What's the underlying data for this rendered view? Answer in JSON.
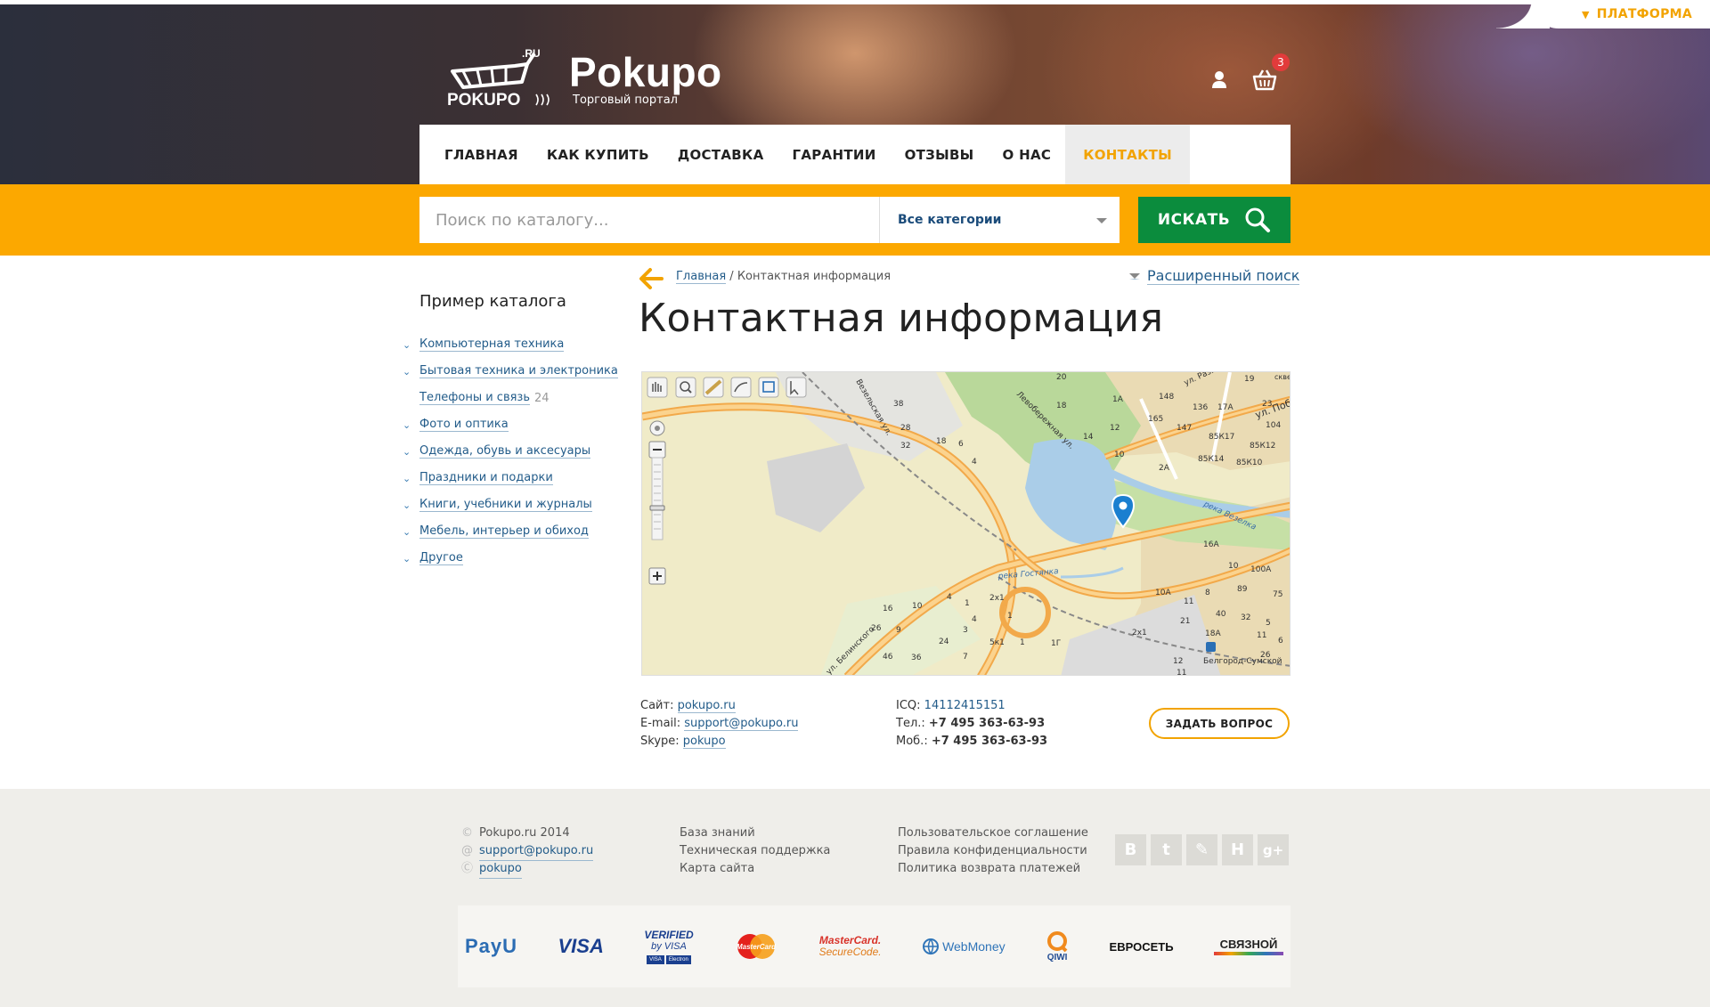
{
  "header": {
    "platform_label": "ПЛАТФОРМА",
    "logo_title": "Pokupo",
    "logo_subtitle": "Торговый портал",
    "logo_mark_text": "POKUPO",
    "logo_ru": ".RU",
    "cart_count": "3"
  },
  "nav": {
    "items": [
      {
        "label": "ГЛАВНАЯ"
      },
      {
        "label": "КАК КУПИТЬ"
      },
      {
        "label": "ДОСТАВКА"
      },
      {
        "label": "ГАРАНТИИ"
      },
      {
        "label": "ОТЗЫВЫ"
      },
      {
        "label": "О НАС"
      },
      {
        "label": "КОНТАКТЫ"
      }
    ],
    "active": "КОНТАКТЫ"
  },
  "search": {
    "placeholder": "Поиск по каталогу...",
    "category": "Все категории",
    "button": "ИСКАТЬ"
  },
  "sidebar": {
    "title": "Пример каталога",
    "items": [
      {
        "label": "Компьютерная техника"
      },
      {
        "label": "Бытовая техника и электроника"
      },
      {
        "label": "Телефоны и связь",
        "count": "24"
      },
      {
        "label": "Фото и оптика"
      },
      {
        "label": "Одежда, обувь и аксесуары"
      },
      {
        "label": "Праздники и подарки"
      },
      {
        "label": "Книги, учебники и журналы"
      },
      {
        "label": "Мебель, интерьер и обиход"
      },
      {
        "label": "Другое"
      }
    ]
  },
  "breadcrumb": {
    "home": "Главная",
    "separator": "/",
    "current": "Контактная информация"
  },
  "advanced_search": "Расширенный поиск",
  "page_title": "Контактная информация",
  "map": {
    "labels": {
      "street1": "ул. Победы",
      "street2": "Везельская ул.",
      "street3": "Левобережная ул.",
      "street4": "ул. Разина",
      "river1": "река Везелка",
      "river2": "река Гостянка",
      "station": "Белгород-Сумской",
      "street5": "ул. Белинского",
      "corner": "сквер",
      "n20": "20",
      "n38": "38",
      "n28": "28",
      "n32": "32",
      "n18a": "18",
      "n6": "6",
      "n4": "4",
      "n18b": "18",
      "n14": "14",
      "n12": "12",
      "n10": "10",
      "n2a": "2А",
      "n1a": "1А",
      "n148": "148",
      "n165": "165",
      "n147": "147",
      "n85k17": "85К17",
      "n85k14": "85К14",
      "n85k10": "85К10",
      "n85k12": "85К12",
      "n104": "104",
      "n23": "23",
      "n17a": "17А",
      "n136": "136",
      "n19": "19",
      "n16a": "16А",
      "n100a": "100А",
      "n10b": "10",
      "n89": "89",
      "n75": "75",
      "n10a": "10А",
      "n11": "11",
      "n8": "8",
      "n40": "40",
      "n32b": "32",
      "n21": "21",
      "n18ab": "18А",
      "n5": "5",
      "n2x1": "2х1",
      "n2x1b": "2х1",
      "n16": "16",
      "n10c": "10",
      "n26": "26",
      "n9": "9",
      "n24": "24",
      "n46": "46",
      "n36": "36",
      "n7": "7",
      "n5k1": "5к1",
      "n1": "1",
      "n1g": "1Г",
      "n12b": "12",
      "n11b": "11",
      "n4b": "4",
      "n1b": "1",
      "n26b": "26",
      "n6b": "6",
      "n11c": "11",
      "n4c": "4",
      "n3": "3",
      "n1c": "1"
    }
  },
  "contacts": {
    "site_label": "Сайт:",
    "site_value": "pokupo.ru",
    "email_label": "E-mail:",
    "email_value": "support@pokupo.ru",
    "skype_label": "Skype:",
    "skype_value": "pokupo",
    "icq_label": "ICQ:",
    "icq_value": "14112415151",
    "tel_label": "Тел.:",
    "tel_value": "+7 495 363-63-93",
    "mob_label": "Моб.:",
    "mob_value": "+7 495 363-63-93",
    "ask_button": "ЗАДАТЬ ВОПРОС"
  },
  "footer": {
    "copyright": "Pokupo.ru 2014",
    "email": "support@pokupo.ru",
    "skype": "pokupo",
    "col2": [
      "База знаний",
      "Техническая поддержка",
      "Карта сайта"
    ],
    "col3": [
      "Пользовательское соглашение",
      "Правила конфиденциальности",
      "Политика возврата платежей"
    ],
    "socials": [
      "В",
      "t",
      "✎",
      "Н",
      "g+"
    ]
  },
  "payments": {
    "payu": "PayU",
    "visa": "VISA",
    "verified_1": "VERIFIED",
    "verified_2": "by VISA",
    "verified_card1": "VISA",
    "verified_card2": "Electron",
    "mastercard": "MasterCard",
    "mc_securecode_1": "MasterCard.",
    "mc_securecode_2": "SecureCode.",
    "webmoney": "WebMoney",
    "qiwi": "QIWI",
    "euroset": "ЕВРОСЕТЬ",
    "svyaznoy": "СВЯЗНОЙ"
  },
  "colors": {
    "accent": "#fca800",
    "search_button": "#0b8c3d",
    "link": "#235c8a",
    "badge": "#e23b3b"
  }
}
